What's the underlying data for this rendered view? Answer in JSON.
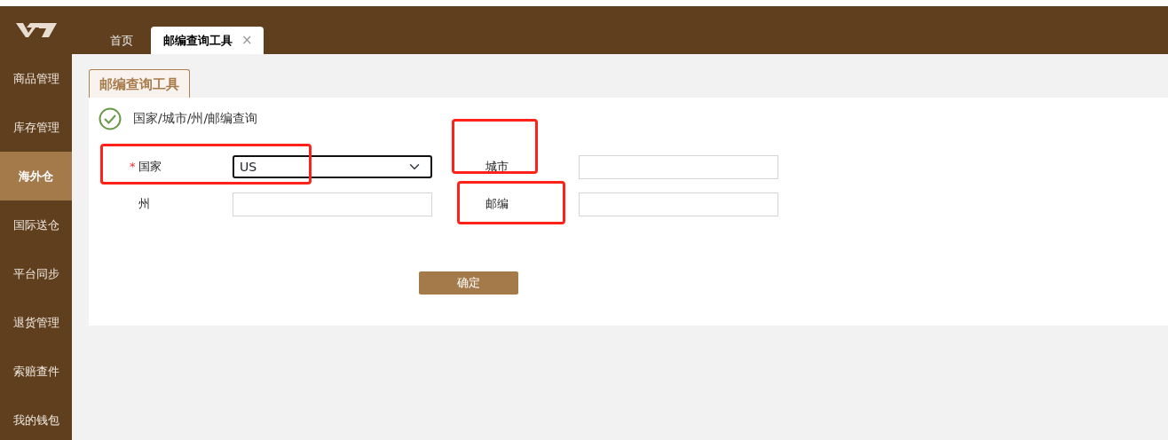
{
  "top_tabs": [
    {
      "label": "首页",
      "selected": false,
      "closable": false
    },
    {
      "label": "邮编查询工具",
      "selected": true,
      "closable": true,
      "close_icon": "×"
    }
  ],
  "sidebar": {
    "items": [
      {
        "label": "商品管理",
        "selected": false
      },
      {
        "label": "库存管理",
        "selected": false
      },
      {
        "label": "海外仓",
        "selected": true
      },
      {
        "label": "国际送仓",
        "selected": false
      },
      {
        "label": "平台同步",
        "selected": false
      },
      {
        "label": "退货管理",
        "selected": false
      },
      {
        "label": "索赔查件",
        "selected": false
      },
      {
        "label": "我的钱包",
        "selected": false
      }
    ]
  },
  "page_tab": "邮编查询工具",
  "section_title": "国家/城市/州/邮编查询",
  "fields": [
    {
      "kind": "select",
      "label": "国家",
      "required": true,
      "required_mark": "*",
      "value": "US",
      "highlighted": true
    },
    {
      "kind": "input",
      "label": "城市",
      "required": false,
      "highlighted": true
    },
    {
      "kind": "input",
      "label": "州",
      "required": false,
      "highlighted": false
    },
    {
      "kind": "input",
      "label": "邮编",
      "required": false,
      "highlighted": true
    }
  ],
  "submit_button": "确定"
}
